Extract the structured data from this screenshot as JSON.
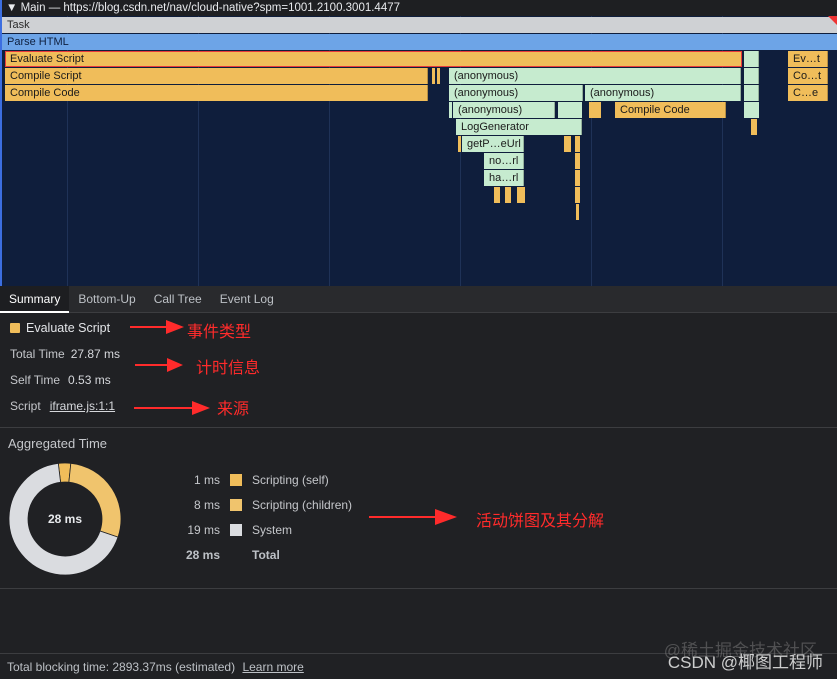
{
  "track": {
    "title": "▼ Main — https://blog.csdn.net/nav/cloud-native?spm=1001.2100.3001.4477"
  },
  "flame": {
    "task": "Task",
    "parse": "Parse HTML",
    "evaluate": "Evaluate Script",
    "compile_script": "Compile Script",
    "compile_code": "Compile Code",
    "anon1": "(anonymous)",
    "anon2": "(anonymous)",
    "anon3": "(anonymous)",
    "anon4": "(anonymous)",
    "compile_code2": "Compile Code",
    "log_gen": "LogGenerator",
    "get_url": "getP…eUrl",
    "no_rl": "no…rl",
    "ha_rl": "ha…rl",
    "right_ev": "Ev…t",
    "right_co": "Co…t",
    "right_ce": "C…e"
  },
  "tabs": [
    "Summary",
    "Bottom-Up",
    "Call Tree",
    "Event Log"
  ],
  "summary": {
    "event_name": "Evaluate Script",
    "event_color": "#f0bd5a",
    "total_time_label": "Total Time",
    "total_time_value": "27.87 ms",
    "self_time_label": "Self Time",
    "self_time_value": "0.53 ms",
    "script_label": "Script",
    "script_link": "iframe.js:1:1"
  },
  "annotations": {
    "event_type": "事件类型",
    "timing_info": "计时信息",
    "source": "来源",
    "pie_breakdown": "活动饼图及其分解"
  },
  "aggregated": {
    "title": "Aggregated Time",
    "center_label": "28 ms",
    "legend": [
      {
        "ms": "1 ms",
        "label": "Scripting (self)",
        "color": "#f0bd5a",
        "value": 1
      },
      {
        "ms": "8 ms",
        "label": "Scripting (children)",
        "color": "#f0c46d",
        "value": 8
      },
      {
        "ms": "19 ms",
        "label": "System",
        "color": "#dadce0",
        "value": 19
      }
    ],
    "total_ms": "28 ms",
    "total_label": "Total"
  },
  "footer": {
    "text": "Total blocking time: 2893.37ms (estimated)",
    "link": "Learn more"
  },
  "watermark": {
    "line1": "@稀土掘金技术社区",
    "line2": "CSDN @椰图工程师"
  }
}
